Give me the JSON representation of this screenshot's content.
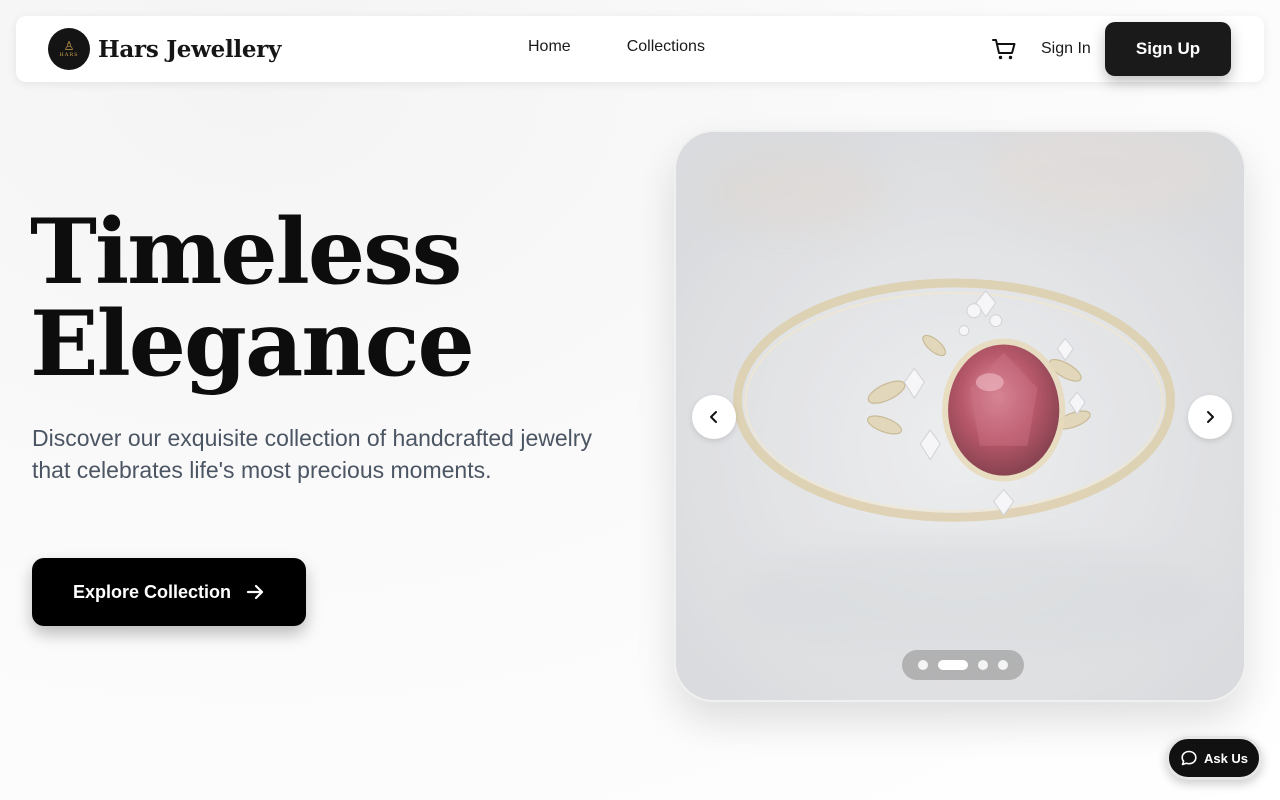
{
  "header": {
    "logo_mark": "♙",
    "logo_text": "HARS",
    "brand_name": "Hars Jewellery",
    "nav": [
      {
        "label": "Home"
      },
      {
        "label": "Collections"
      }
    ],
    "cart_icon": "cart-icon",
    "signin_label": "Sign In",
    "signup_label": "Sign Up"
  },
  "hero": {
    "title_line1": "Timeless",
    "title_line2": "Elegance",
    "subtitle": "Discover our exquisite collection of handcrafted jewelry that celebrates life's most precious moments.",
    "cta_label": "Explore Collection",
    "cta_icon": "arrow-right-icon"
  },
  "carousel": {
    "slide_count": 4,
    "active_slide": 2,
    "prev_icon": "chevron-left-icon",
    "next_icon": "chevron-right-icon"
  },
  "chat": {
    "label": "Ask Us",
    "icon": "chat-bubble-icon"
  },
  "colors": {
    "primary": "#000000",
    "text_muted": "#4b5563",
    "gem": "#a8344a",
    "gold": "#c9a24a"
  }
}
